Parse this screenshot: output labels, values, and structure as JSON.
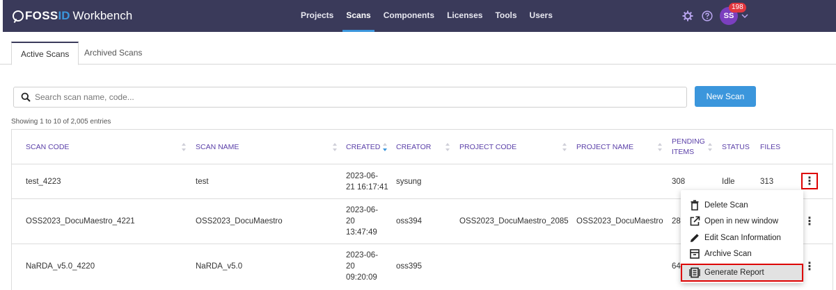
{
  "app": {
    "logo_part1": "FOSS",
    "logo_part2": "ID",
    "logo_part3": "Workbench"
  },
  "nav": {
    "items": [
      "Projects",
      "Scans",
      "Components",
      "Licenses",
      "Tools",
      "Users"
    ],
    "active": "Scans"
  },
  "user": {
    "initials": "SS",
    "notification_count": "198"
  },
  "tabs": {
    "active": "Active Scans",
    "archived": "Archived Scans"
  },
  "search": {
    "placeholder": "Search scan name, code...",
    "value": ""
  },
  "new_scan_label": "New Scan",
  "entries_text": "Showing 1 to 10 of 2,005 entries",
  "table": {
    "headers": {
      "scan_code": "SCAN CODE",
      "scan_name": "SCAN NAME",
      "created": "CREATED",
      "creator": "CREATOR",
      "project_code": "PROJECT CODE",
      "project_name": "PROJECT NAME",
      "pending_1": "PENDING",
      "pending_2": "ITEMS",
      "status": "STATUS",
      "files": "FILES"
    },
    "rows": [
      {
        "scan_code": "test_4223",
        "scan_name": "test",
        "created_1": "2023-06-",
        "created_2": "21 16:17:41",
        "created_3": "",
        "creator": "sysung",
        "project_code": "",
        "project_name": "",
        "pending": "308",
        "status": "Idle",
        "files": "313"
      },
      {
        "scan_code": "OSS2023_DocuMaestro_4221",
        "scan_name": "OSS2023_DocuMaestro",
        "created_1": "2023-06-",
        "created_2": "20",
        "created_3": "13:47:49",
        "creator": "oss394",
        "project_code": "OSS2023_DocuMaestro_2085",
        "project_name": "OSS2023_DocuMaestro",
        "pending": "28",
        "status": "",
        "files": ""
      },
      {
        "scan_code": "NaRDA_v5.0_4220",
        "scan_name": "NaRDA_v5.0",
        "created_1": "2023-06-",
        "created_2": "20",
        "created_3": "09:20:09",
        "creator": "oss395",
        "project_code": "",
        "project_name": "",
        "pending": "64",
        "status": "",
        "files": ""
      }
    ]
  },
  "context_menu": {
    "delete": "Delete Scan",
    "open_new_window": "Open in new window",
    "edit": "Edit Scan Information",
    "archive": "Archive Scan",
    "generate_report": "Generate Report"
  },
  "colors": {
    "nav_bg": "#3a3a5a",
    "accent": "#3b96dc",
    "header_text": "#5a3fa8",
    "avatar": "#7b3fbf",
    "badge": "#e2373f",
    "highlight": "#dd0000"
  }
}
